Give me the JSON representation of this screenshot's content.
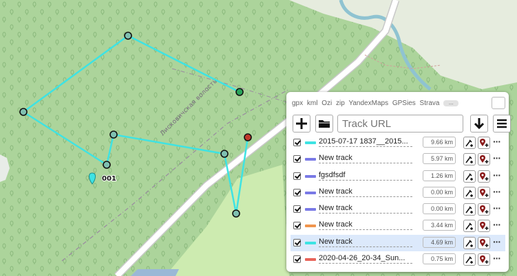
{
  "map": {
    "region_label": "Лисковичская волость",
    "waypoint_label": "001",
    "route_color": "#3ee3e3",
    "vertex_color": "#1e2a2a",
    "start_color": "#2aa55a",
    "end_color": "#c0392b",
    "road_color": "#ffffff",
    "river_color": "#8fc3d1"
  },
  "panel": {
    "formats": [
      "gpx",
      "kml",
      "Ozi",
      "zip",
      "YandexMaps",
      "GPSies",
      "Strava"
    ],
    "more_label": "...",
    "minimize_icon": "↘",
    "toolbar": {
      "add_icon": "+",
      "open_icon": "folder",
      "url_placeholder": "Track URL",
      "download_icon": "↓",
      "menu_icon": "≡"
    },
    "tracks": [
      {
        "name": "2015-07-17 1837__2015...",
        "color": "#3ee3e3",
        "distance": "9.66 km",
        "highlighted": false
      },
      {
        "name": "New track",
        "color": "#7a7ae6",
        "distance": "5.97 km",
        "highlighted": false
      },
      {
        "name": "fgsdfsdf",
        "color": "#7a7ae6",
        "distance": "1.26 km",
        "highlighted": false
      },
      {
        "name": "New track",
        "color": "#7a7ae6",
        "distance": "0.00 km",
        "highlighted": false
      },
      {
        "name": "New track",
        "color": "#7a7ae6",
        "distance": "0.00 km",
        "highlighted": false
      },
      {
        "name": "New track",
        "color": "#f0954d",
        "distance": "3.44 km",
        "highlighted": false
      },
      {
        "name": "New track",
        "color": "#3ee3e3",
        "distance": "4.69 km",
        "highlighted": true
      },
      {
        "name": "2020-04-26_20-34_Sun...",
        "color": "#e8645a",
        "distance": "0.75 km",
        "highlighted": false
      }
    ],
    "row_more_label": "···"
  }
}
